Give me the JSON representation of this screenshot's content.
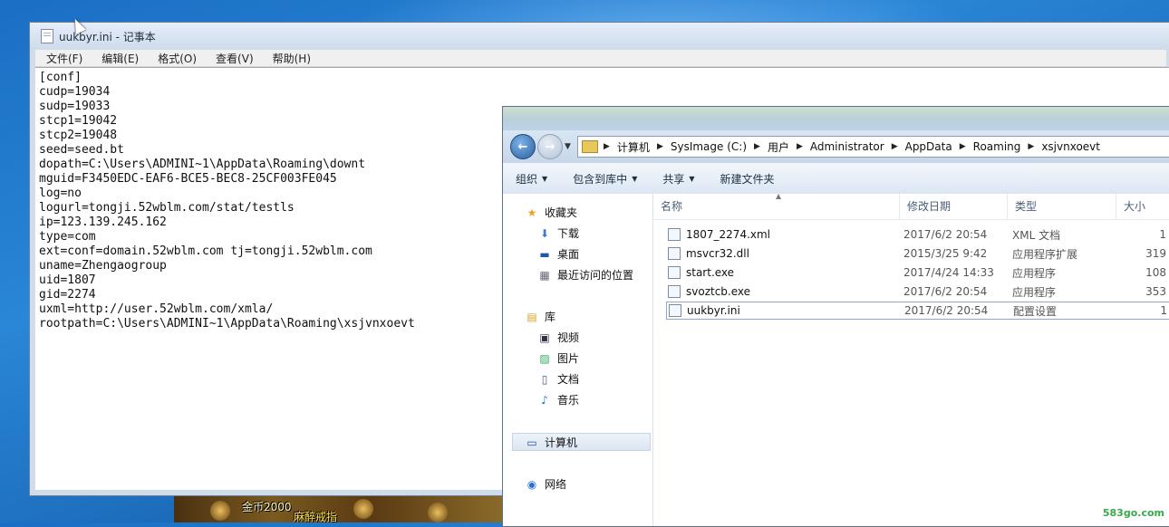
{
  "game_banner": {
    "coins": "金币2000",
    "item": "麻醉戒指"
  },
  "notepad": {
    "title": "uukbyr.ini - 记事本",
    "menu": [
      "文件(F)",
      "编辑(E)",
      "格式(O)",
      "查看(V)",
      "帮助(H)"
    ],
    "content": "[conf]\ncudp=19034\nsudp=19033\nstcp1=19042\nstcp2=19048\nseed=seed.bt\ndopath=C:\\Users\\ADMINI~1\\AppData\\Roaming\\downt\nmguid=F3450EDC-EAF6-BCE5-BEC8-25CF003FE045\nlog=no\nlogurl=tongji.52wblm.com/stat/testls\nip=123.139.245.162\ntype=com\next=conf=domain.52wblm.com tj=tongji.52wblm.com\nuname=Zhengaogroup\nuid=1807\ngid=2274\nuxml=http://user.52wblm.com/xmla/\nrootpath=C:\\Users\\ADMINI~1\\AppData\\Roaming\\xsjvnxoevt"
  },
  "explorer": {
    "breadcrumb": [
      "计算机",
      "SysImage (C:)",
      "用户",
      "Administrator",
      "AppData",
      "Roaming",
      "xsjvnxoevt"
    ],
    "toolbar": {
      "organize": "组织",
      "include_library": "包含到库中",
      "share": "共享",
      "new_folder": "新建文件夹"
    },
    "nav": {
      "favorites": "收藏夹",
      "downloads": "下载",
      "desktop": "桌面",
      "recent": "最近访问的位置",
      "libraries": "库",
      "videos": "视频",
      "pictures": "图片",
      "documents": "文档",
      "music": "音乐",
      "computer": "计算机",
      "network": "网络"
    },
    "columns": {
      "name": "名称",
      "date": "修改日期",
      "type": "类型",
      "size": "大小"
    },
    "files": [
      {
        "name": "1807_2274.xml",
        "date": "2017/6/2 20:54",
        "type": "XML 文档",
        "size": "1"
      },
      {
        "name": "msvcr32.dll",
        "date": "2015/3/25 9:42",
        "type": "应用程序扩展",
        "size": "319"
      },
      {
        "name": "start.exe",
        "date": "2017/4/24 14:33",
        "type": "应用程序",
        "size": "108"
      },
      {
        "name": "svoztcb.exe",
        "date": "2017/6/2 20:54",
        "type": "应用程序",
        "size": "353"
      },
      {
        "name": "uukbyr.ini",
        "date": "2017/6/2 20:54",
        "type": "配置设置",
        "size": "1"
      }
    ]
  },
  "watermark": "583go.com"
}
